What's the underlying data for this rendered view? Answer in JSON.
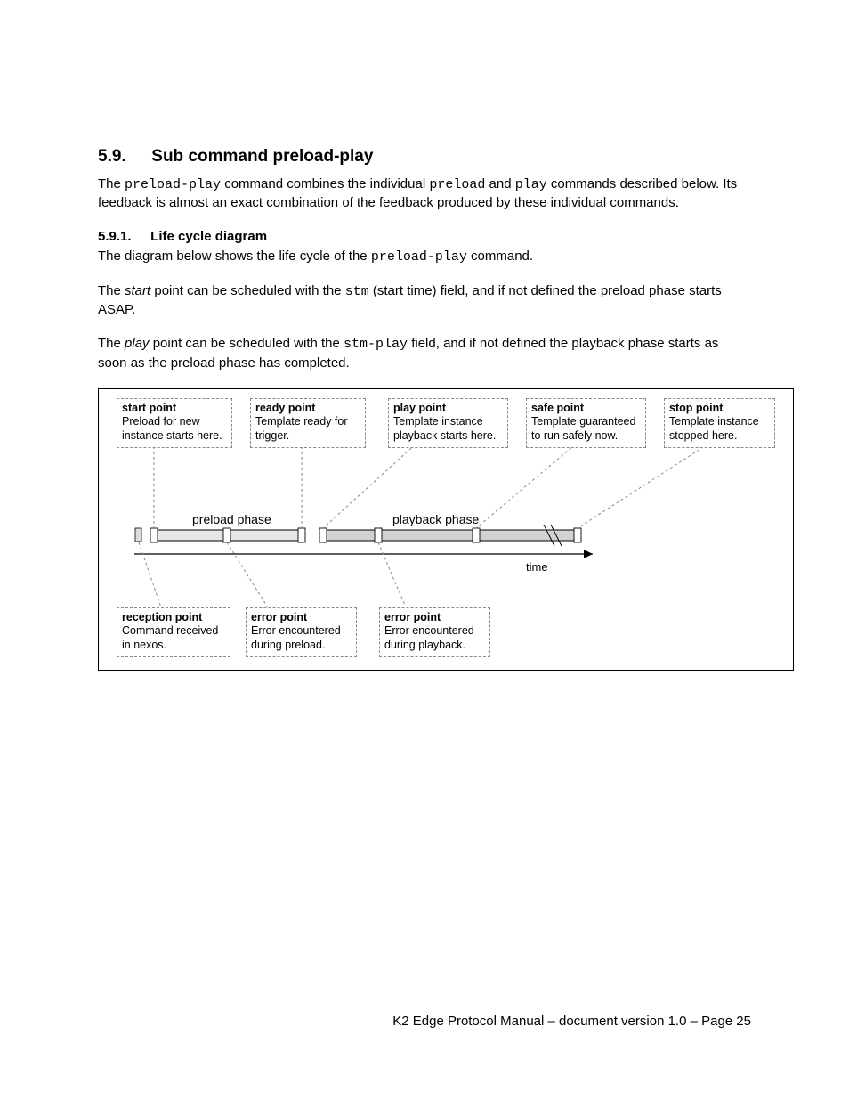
{
  "heading": {
    "num": "5.9.",
    "title": "Sub command preload-play"
  },
  "p1": {
    "t1": "The ",
    "c1": "preload-play",
    "t2": " command combines the individual ",
    "c2": "preload",
    "t3": " and ",
    "c3": "play",
    "t4": " commands described below. Its feedback is almost an exact combination of the feedback produced by these individual commands."
  },
  "sub": {
    "num": "5.9.1.",
    "title": "Life cycle diagram"
  },
  "p2": {
    "t1": "The diagram below shows the life cycle of the ",
    "c1": "preload-play",
    "t2": " command."
  },
  "p3": {
    "t1": "The ",
    "i1": "start",
    "t2": " point can be scheduled with the ",
    "c1": "stm",
    "t3": " (start time) field, and if not defined the preload phase starts ASAP."
  },
  "p4": {
    "t1": "The ",
    "i1": "play",
    "t2": " point can be scheduled with the ",
    "c1": "stm-play",
    "t3": " field, and if not defined the playback phase starts as soon as the preload phase has completed."
  },
  "diagram": {
    "phases": {
      "preload": "preload phase",
      "playback": "playback phase"
    },
    "time": "time",
    "top": {
      "start": {
        "b": "start point",
        "d": "Preload for new instance starts here."
      },
      "ready": {
        "b": "ready point",
        "d": "Template ready for trigger."
      },
      "play": {
        "b": "play point",
        "d": "Template instance playback starts here."
      },
      "safe": {
        "b": "safe point",
        "d": "Template guaranteed to run safely now."
      },
      "stop": {
        "b": "stop point",
        "d": "Template instance stopped here."
      }
    },
    "bottom": {
      "recv": {
        "b": "reception  point",
        "d": "Command received in nexos."
      },
      "err1": {
        "b": "error point",
        "d": "Error encountered during preload."
      },
      "err2": {
        "b": "error point",
        "d": "Error encountered during playback."
      }
    }
  },
  "footer": "K2 Edge Protocol Manual – document version 1.0 – Page 25"
}
